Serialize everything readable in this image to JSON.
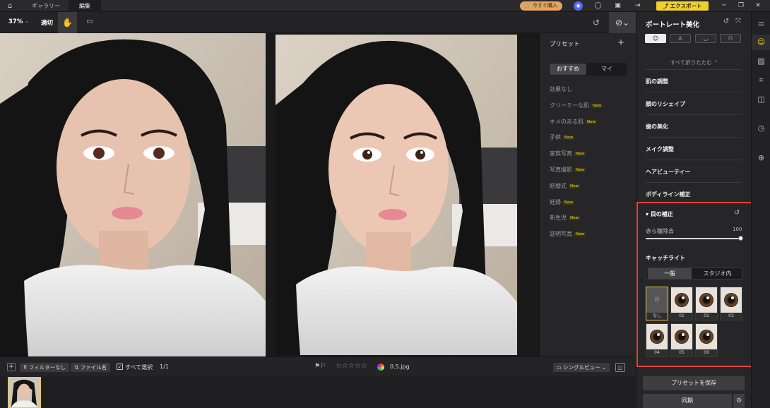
{
  "titlebar": {
    "tabs": [
      "ギャラリー",
      "編集"
    ],
    "buy_label": "今すぐ購入",
    "export_label": "エクスポート"
  },
  "toolbar": {
    "zoom": "37%",
    "fit_label": "適切"
  },
  "preset_panel": {
    "title": "プリセット",
    "tabs": [
      "おすすめ",
      "マイ"
    ],
    "new_badge": "New",
    "items": [
      {
        "label": "効果なし",
        "is_new": false
      },
      {
        "label": "クリーミーな肌",
        "is_new": true
      },
      {
        "label": "キメのある肌",
        "is_new": true
      },
      {
        "label": "子供",
        "is_new": true
      },
      {
        "label": "家族写真",
        "is_new": true
      },
      {
        "label": "写真撮影",
        "is_new": true
      },
      {
        "label": "結婚式",
        "is_new": true
      },
      {
        "label": "妊婦",
        "is_new": true
      },
      {
        "label": "新生児",
        "is_new": true
      },
      {
        "label": "証明写真",
        "is_new": true
      }
    ]
  },
  "right_panel": {
    "title": "ポートレート美化",
    "collapse_all": "すべて折りたたむ ⌃",
    "sections": [
      "肌の調整",
      "顔のリシェイプ",
      "歯の美化",
      "メイク調整",
      "ヘアビューティー",
      "ボディライン補正"
    ],
    "eye_section": {
      "title": "目の補正",
      "red_eye_label": "赤ら瞳除去",
      "red_eye_value": "100",
      "red_eye_level": 1.0,
      "catchlight_title": "キャッチライト",
      "catchlight_tabs": [
        "一般",
        "スタジオ内"
      ],
      "thumbs": [
        "なし",
        "01",
        "02",
        "03",
        "04",
        "05",
        "06"
      ]
    },
    "save_preset_label": "プリセットを保存",
    "sync_label": "同期"
  },
  "bottombar": {
    "filter_label": "フィルターなし",
    "filename_label": "ファイル名",
    "select_all_label": "すべて選択",
    "count": "1/1",
    "filename": "0.5.jpg",
    "view_label": "シングルビュー"
  },
  "colors": {
    "accent_yellow": "#f1cf2d",
    "buy_orange": "#e2a45f",
    "highlight_red": "#e2443c",
    "new_badge": "#f0d028"
  }
}
